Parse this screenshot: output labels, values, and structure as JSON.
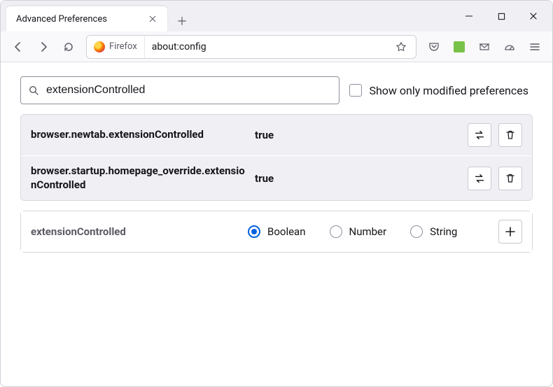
{
  "window": {
    "tab_title": "Advanced Preferences"
  },
  "urlbar": {
    "identity_label": "Firefox",
    "url": "about:config"
  },
  "search": {
    "value": "extensionControlled",
    "modified_only_label": "Show only modified preferences"
  },
  "prefs": [
    {
      "name": "browser.newtab.extensionControlled",
      "value": "true"
    },
    {
      "name": "browser.startup.homepage_override.extensionControlled",
      "value": "true"
    }
  ],
  "add": {
    "name": "extensionControlled",
    "types": {
      "boolean": "Boolean",
      "number": "Number",
      "string": "String"
    },
    "selected_type": "boolean"
  }
}
